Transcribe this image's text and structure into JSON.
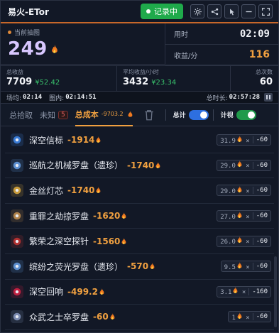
{
  "app": {
    "title": "易火-ETor"
  },
  "header": {
    "record_label": "记录中"
  },
  "map": {
    "label": "当前抽图",
    "value": "249"
  },
  "time": {
    "label": "用时",
    "value": "02:09"
  },
  "rate": {
    "label": "收益/分",
    "value": "116"
  },
  "kpis": {
    "total_income_label": "总收益",
    "total_income": "7709",
    "total_income_money": "¥52.42",
    "avg_hour_label": "平均收益/小时",
    "avg_hour": "3432",
    "avg_hour_money": "¥23.34",
    "count_label": "总次数",
    "count": "60"
  },
  "timers": {
    "field_label": "场均:",
    "field_value": "02:14",
    "in_map_label": "图内:",
    "in_map_value": "02:14:51",
    "total_label": "总时长:",
    "total_value": "02:57:28"
  },
  "tabs": {
    "pickup": "总拾取",
    "unknown": "未知",
    "unknown_count": "5",
    "cost": "总成本",
    "cost_value": "-9703.2",
    "total_label": "总计",
    "count_label": "计视"
  },
  "colors": {
    "accent": "#f0a040",
    "record_green": "#1faa4b",
    "toggle_blue": "#2d6fe0",
    "toggle_green": "#1f9a4a"
  },
  "items": [
    {
      "name": "深空信标",
      "cost": "-1914",
      "price": "31.9",
      "qty": "-60",
      "icon": "beacon-icon",
      "color": "#3a7bd5"
    },
    {
      "name": "巡航之机械罗盘（遗珍）",
      "cost": "-1740",
      "price": "29.0",
      "qty": "-60",
      "icon": "compass-icon",
      "color": "#5c8fd0"
    },
    {
      "name": "金丝灯芯",
      "cost": "-1740",
      "price": "29.0",
      "qty": "-60",
      "icon": "wick-icon",
      "color": "#c79a3a"
    },
    {
      "name": "重罪之劫掠罗盘",
      "cost": "-1620",
      "price": "27.0",
      "qty": "-60",
      "icon": "compass-icon",
      "color": "#b0824a"
    },
    {
      "name": "繁荣之深空探针",
      "cost": "-1560",
      "price": "26.0",
      "qty": "-60",
      "icon": "probe-icon",
      "color": "#b03030"
    },
    {
      "name": "缤纷之荧光罗盘（遗珍）",
      "cost": "-570",
      "price": "9.5",
      "qty": "-60",
      "icon": "compass-icon",
      "color": "#5c8fd0"
    },
    {
      "name": "深空回响",
      "cost": "-499.2",
      "price": "3.1",
      "qty": "-160",
      "icon": "echo-icon",
      "color": "#c02040"
    },
    {
      "name": "众武之士卒罗盘",
      "cost": "-60",
      "price": "1",
      "qty": "-60",
      "icon": "compass-icon",
      "color": "#7a8ab0"
    }
  ]
}
